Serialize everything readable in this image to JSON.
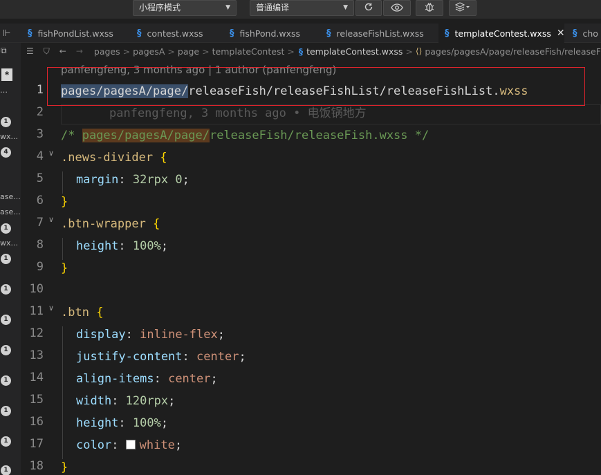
{
  "toolbar": {
    "mode_select": "小程序模式",
    "compile_select": "普通编译"
  },
  "tabs": [
    {
      "label": "fishPondList.wxss",
      "active": false
    },
    {
      "label": "contest.wxss",
      "active": false
    },
    {
      "label": "fishPond.wxss",
      "active": false
    },
    {
      "label": "releaseFishList.wxss",
      "active": false
    },
    {
      "label": "templateContest.wxss",
      "active": true
    },
    {
      "label": "cho",
      "active": false
    }
  ],
  "breadcrumb": [
    "pages",
    "pagesA",
    "page",
    "templateContest",
    "templateContest.wxss",
    "pages/pagesA/page/releaseFish/releaseFishList/releaseFishLis"
  ],
  "sidebar": {
    "texts": [
      "wx...",
      "ase...",
      "ase...",
      "wx..."
    ],
    "badges": [
      "1",
      "4",
      "1",
      "1",
      "1",
      "1",
      "1",
      "1",
      "1",
      "1",
      "1"
    ]
  },
  "editor": {
    "blame_header": "panfengfeng, 3 months ago | 1 author (panfengfeng)",
    "line1_selected": "pages/pagesA/page/",
    "line1_rest": "releaseFish/releaseFishList/releaseFishList.",
    "line1_ext": "wxss",
    "line2_blame": "panfengfeng, 3 months ago • 电饭锅地方",
    "line3_open": "/* ",
    "line3_highlight": "pages/pagesA/page/",
    "line3_rest": "releaseFish/releaseFish.wxss */",
    "news_divider": ".news-divider",
    "btn_wrapper": ".btn-wrapper",
    "btn": ".btn",
    "margin_prop": "margin",
    "margin_val": "32rpx 0",
    "height_prop": "height",
    "height_val": "100%",
    "display_prop": "display",
    "display_val": "inline-flex",
    "justify_prop": "justify-content",
    "justify_val": "center",
    "align_prop": "align-items",
    "align_val": "center",
    "width_prop": "width",
    "width_val": "120rpx",
    "height2_prop": "height",
    "height2_val": "100%",
    "color_prop": "color",
    "color_val": "white",
    "line_numbers": [
      "1",
      "2",
      "3",
      "4",
      "5",
      "6",
      "7",
      "8",
      "9",
      "10",
      "11",
      "12",
      "13",
      "14",
      "15",
      "16",
      "17",
      "18"
    ]
  }
}
